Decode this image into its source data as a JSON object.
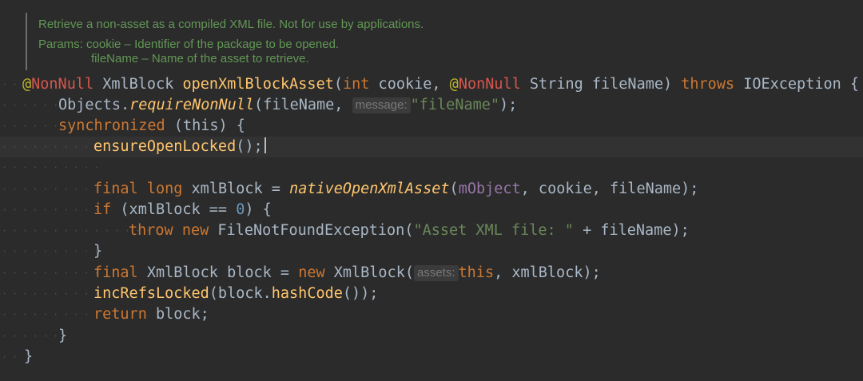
{
  "doc": {
    "summary": "Retrieve a non-asset as a compiled XML file. Not for use by applications.",
    "params_label": "Params:",
    "param1": "cookie – Identifier of the package to be opened.",
    "param2": "fileName – Name of the asset to retrieve."
  },
  "code": {
    "l1": {
      "at": "@",
      "annotation1": "NonNull",
      "type": " XmlBlock ",
      "method": "openXmlBlockAsset",
      "paren_open": "(",
      "kw_int": "int",
      "param_cookie": " cookie, ",
      "at2": "@",
      "annotation2": "NonNull",
      "param_string": " String fileName) ",
      "kw_throws": "throws",
      "exception": " IOException {"
    },
    "l2": {
      "prefix": "Objects.",
      "method": "requireNonNull",
      "args_start": "(fileName, ",
      "hint": "message:",
      "string": "\"fileName\"",
      "end": ");"
    },
    "l3": {
      "kw": "synchronized",
      "rest": " (this) {"
    },
    "l4": {
      "call": "ensureOpenLocked",
      "end": "();"
    },
    "l6": {
      "kw1": "final",
      "kw2": "long",
      "var": " xmlBlock = ",
      "method": "nativeOpenXmlAsset",
      "paren": "(",
      "field": "mObject",
      "args": ", cookie, fileName);"
    },
    "l7": {
      "kw": "if",
      "cond": " (xmlBlock == ",
      "num": "0",
      "end": ") {"
    },
    "l8": {
      "kw1": "throw",
      "kw2": "new",
      "cls": " FileNotFoundException",
      "paren": "(",
      "string": "\"Asset XML file: \"",
      "end": " + fileName);"
    },
    "l9": {
      "text": "}"
    },
    "l10": {
      "kw": "final",
      "decl": " XmlBlock block = ",
      "kw_new": "new",
      "cls": " XmlBlock",
      "paren": "(",
      "hint": "assets:",
      "kw_this": "this",
      "end": ", xmlBlock);"
    },
    "l11": {
      "call": "incRefsLocked",
      "mid": "(block.",
      "call2": "hashCode",
      "end": "());"
    },
    "l12": {
      "kw": "return",
      "rest": " block;"
    },
    "l13": {
      "text": "}"
    },
    "l14": {
      "text": "}"
    }
  }
}
